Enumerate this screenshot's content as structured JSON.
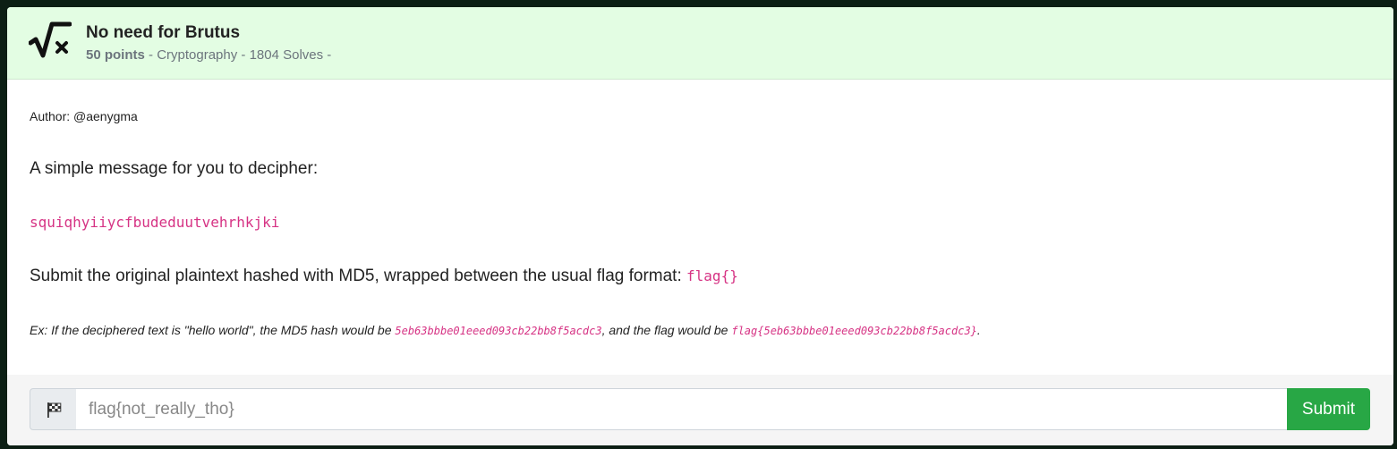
{
  "challenge": {
    "icon": "square-root-x-icon",
    "title": "No need for Brutus",
    "points": "50 points",
    "meta_rest": " - Cryptography - 1804 Solves -"
  },
  "description": {
    "author": "Author: @aenygma",
    "intro": "A simple message for you to decipher:",
    "ciphertext": "squiqhyiiycfbudeduutvehrhkjki",
    "instruction": "Submit the original plaintext hashed with MD5, wrapped between the usual flag format: ",
    "flag_format": "flag{}",
    "example_part1": "Ex: If the deciphered text is \"hello world\", the MD5 hash would be ",
    "example_hash": "5eb63bbbe01eeed093cb22bb8f5acdc3",
    "example_part2": ", and the flag would be ",
    "example_flag": "flag{5eb63bbbe01eeed093cb22bb8f5acdc3}",
    "example_end": "."
  },
  "submission": {
    "addon_icon": "checkered-flag-icon",
    "placeholder": "flag{not_really_tho}",
    "value": "",
    "submit_label": "Submit"
  },
  "colors": {
    "header_bg": "#e3fde3",
    "code": "#d63384",
    "submit_bg": "#28a745"
  }
}
